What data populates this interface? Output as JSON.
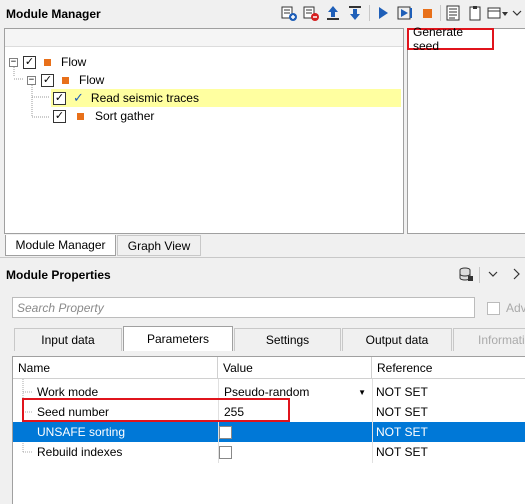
{
  "module_manager": {
    "title": "Module Manager",
    "toolbar_icons": [
      "add-module-icon",
      "remove-module-icon",
      "move-up-icon",
      "move-down-icon",
      "run-icon",
      "step-run-icon",
      "stop-icon",
      "log-icon",
      "clipboard-icon",
      "view-options-icon"
    ],
    "tree": [
      {
        "label": "Flow",
        "expander": "−",
        "checked": true,
        "level": 0
      },
      {
        "label": "Flow",
        "expander": "−",
        "checked": true,
        "level": 1
      },
      {
        "label": "Read seismic traces",
        "checked": true,
        "level": 2,
        "selected": true
      },
      {
        "label": "Sort gather",
        "checked": true,
        "level": 2
      }
    ]
  },
  "right_panel": {
    "generate_seed": "Generate seed"
  },
  "bottom_tabs": [
    {
      "label": "Module Manager",
      "active": true
    },
    {
      "label": "Graph View",
      "active": false
    }
  ],
  "module_properties": {
    "title": "Module Properties",
    "search_placeholder": "Search Property",
    "adv_label": "Adv",
    "tabs": [
      {
        "label": "Input data"
      },
      {
        "label": "Parameters",
        "active": true
      },
      {
        "label": "Settings"
      },
      {
        "label": "Output data"
      },
      {
        "label": "Informatio"
      }
    ],
    "columns": {
      "name": "Name",
      "value": "Value",
      "reference": "Reference"
    },
    "rows": [
      {
        "name": "Work mode",
        "value": "Pseudo-random",
        "reference": "NOT SET",
        "type": "dropdown"
      },
      {
        "name": "Seed number",
        "value": "255",
        "reference": "NOT SET",
        "type": "text"
      },
      {
        "name": "UNSAFE sorting",
        "value": "",
        "reference": "NOT SET",
        "type": "checkbox",
        "selected": true
      },
      {
        "name": "Rebuild indexes",
        "value": "",
        "reference": "NOT SET",
        "type": "checkbox"
      }
    ]
  },
  "colors": {
    "accent_orange": "#e8701a",
    "selection_blue": "#0078d7",
    "highlight_yellow": "#ffffa0",
    "annotation_red": "#e0141c"
  }
}
